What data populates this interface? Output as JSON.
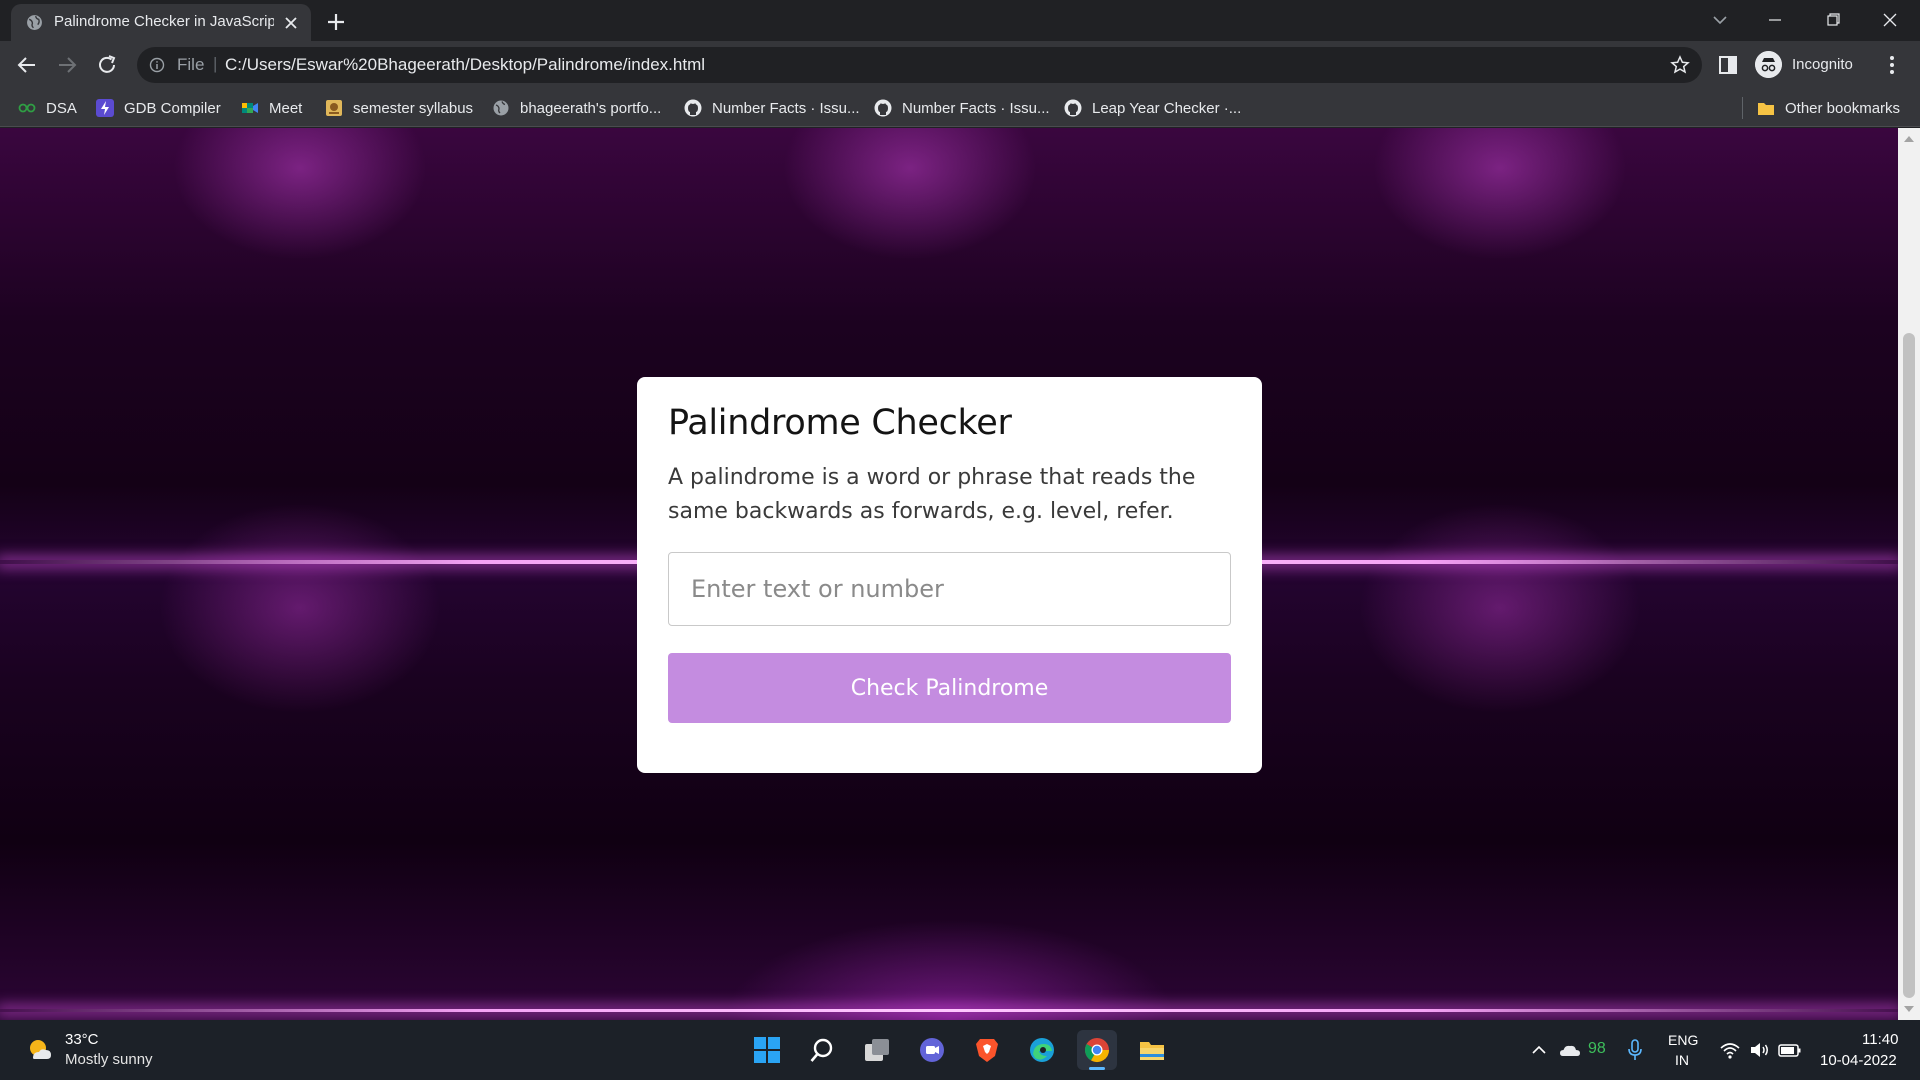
{
  "browser": {
    "tab": {
      "title": "Palindrome Checker in JavaScript",
      "favicon": "globe-icon"
    },
    "address": {
      "scheme_label": "File",
      "url": "C:/Users/Eswar%20Bhageerath/Desktop/Palindrome/index.html"
    },
    "profile": {
      "label": "Incognito",
      "icon": "incognito-icon"
    },
    "bookmarks": [
      {
        "label": "DSA",
        "icon": "dsa-icon"
      },
      {
        "label": "GDB Compiler",
        "icon": "bolt-icon"
      },
      {
        "label": "Meet",
        "icon": "meet-icon"
      },
      {
        "label": "semester syllabus",
        "icon": "document-icon"
      },
      {
        "label": "bhageerath's portfo...",
        "icon": "globe-icon"
      },
      {
        "label": "Number Facts · Issu...",
        "icon": "github-icon"
      },
      {
        "label": "Number Facts · Issu...",
        "icon": "github-icon"
      },
      {
        "label": "Leap Year Checker ·...",
        "icon": "github-icon"
      }
    ],
    "other_bookmarks": "Other bookmarks"
  },
  "page": {
    "title": "Palindrome Checker",
    "description": "A palindrome is a word or phrase that reads the same backwards as forwards, e.g. level, refer.",
    "input": {
      "value": "",
      "placeholder": "Enter text or number"
    },
    "button_label": "Check Palindrome",
    "colors": {
      "button": "#c48ce0",
      "background_accent": "#3a063f"
    }
  },
  "taskbar": {
    "weather": {
      "temp": "33°C",
      "desc": "Mostly sunny"
    },
    "apps": [
      "start-icon",
      "search-icon",
      "task-view-icon",
      "chat-icon",
      "brave-icon",
      "edge-icon",
      "chrome-icon",
      "file-explorer-icon"
    ],
    "tray": {
      "count": "98"
    },
    "language": {
      "top": "ENG",
      "bottom": "IN"
    },
    "clock": {
      "time": "11:40",
      "date": "10-04-2022"
    }
  }
}
